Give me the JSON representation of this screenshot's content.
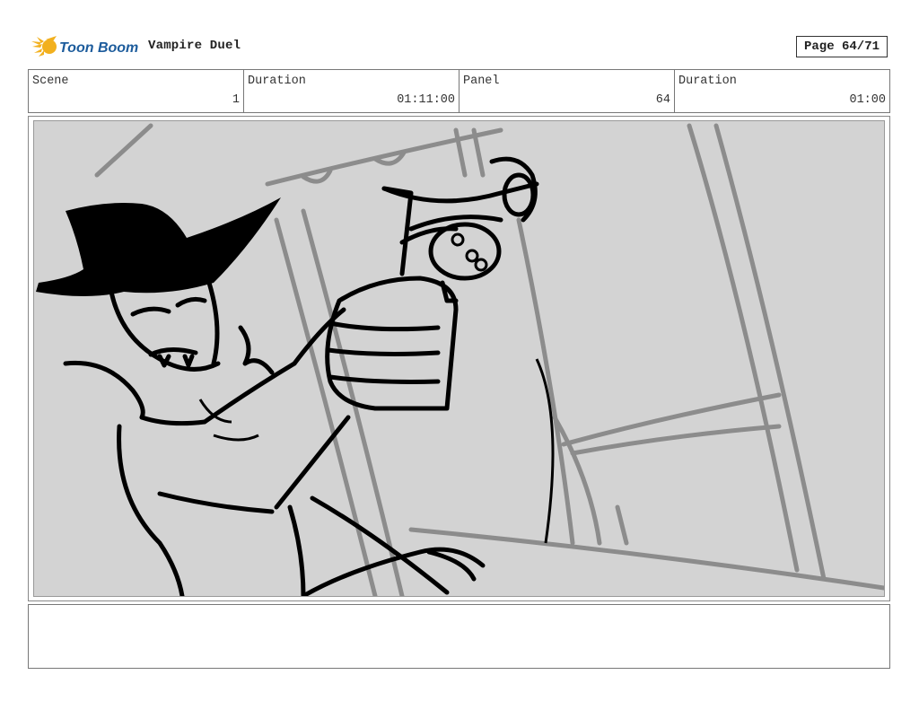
{
  "header": {
    "logo_text": "Toon Boom",
    "project_title": "Vampire Duel",
    "page_label": "Page 64/71"
  },
  "info": {
    "scene_label": "Scene",
    "scene_value": "1",
    "duration_label": "Duration",
    "duration_value": "01:11:00",
    "panel_label": "Panel",
    "panel_value": "64",
    "panel_duration_label": "Duration",
    "panel_duration_value": "01:00"
  },
  "panel": {
    "background_color": "#d3d3d3"
  },
  "notes": {
    "text": ""
  }
}
